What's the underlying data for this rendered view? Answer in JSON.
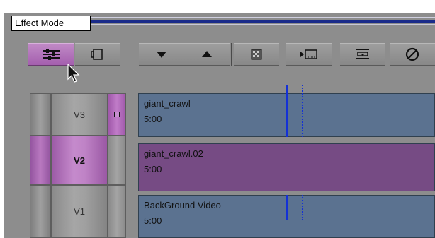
{
  "window": {
    "title": "Effect Mode"
  },
  "toolbar": {
    "buttons": [
      {
        "icon": "effect-mode-sliders-icon",
        "active": true
      },
      {
        "icon": "monitor-frame-icon"
      },
      {
        "icon": "triangle-down-icon"
      },
      {
        "icon": "triangle-up-icon"
      },
      {
        "icon": "render-effect-icon"
      },
      {
        "icon": "step-in-icon"
      },
      {
        "icon": "mark-clip-icon"
      },
      {
        "icon": "remove-effect-icon"
      }
    ]
  },
  "tracks": [
    {
      "label": "V3",
      "active": false,
      "locked": true,
      "clip": {
        "name": "giant_crawl",
        "duration": "5:00",
        "color": "blue"
      }
    },
    {
      "label": "V2",
      "active": true,
      "locked": false,
      "clip": {
        "name": "giant_crawl.02",
        "duration": "5:00",
        "color": "purple"
      }
    },
    {
      "label": "V1",
      "active": false,
      "locked": false,
      "clip": {
        "name": "BackGround Video",
        "duration": "5:00",
        "color": "blue"
      }
    }
  ],
  "colors": {
    "accent_purple": "#a45fae",
    "clip_blue": "#5b7290",
    "clip_purple": "#764b84",
    "cut_line": "#1431d6"
  }
}
